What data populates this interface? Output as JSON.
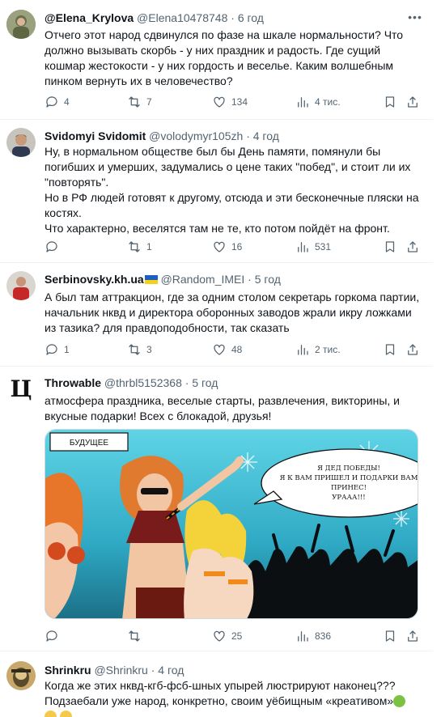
{
  "tweets": [
    {
      "name": "@Elena_Krylova",
      "handle": "@Elena10478748",
      "time": "6 год",
      "lines": [
        "Отчего этот народ сдвинулся по фазе на шкале нормальности? Что",
        "должно вызывать скорбь - у них праздник и радость. Где сущий",
        "кошмар жестокости - у них гордость и веселье. Каким волшебным",
        "пинком вернуть их в человечество?"
      ],
      "replies": "4",
      "reposts": "7",
      "likes": "134",
      "views": "4 тис."
    },
    {
      "name": "Svidomyi Svidomit",
      "handle": "@volodymyr105zh",
      "time": "4 год",
      "lines": [
        "Ну, в нормальном обществе был бы День памяти, помянули бы",
        "погибших и умерших, задумались о цене таких \"побед\", и стоит ли их",
        "\"повторять\".",
        "Но в РФ людей готовят к другому, отсюда и эти бесконечные пляски на",
        "костях.",
        "Что характерно, веселятся там не те, кто потом пойдёт на фронт."
      ],
      "replies": "",
      "reposts": "1",
      "likes": "16",
      "views": "531"
    },
    {
      "name": "Serbinovsky.kh.ua",
      "handle": "@Random_IMEI",
      "time": "5 год",
      "lines": [
        "А был там аттракцион, где за одним столом секретарь горкома партии,",
        "начальник нквд и директора оборонных заводов жрали икру ложками",
        "из тазика? для правдоподобности, так сказать"
      ],
      "replies": "1",
      "reposts": "3",
      "likes": "48",
      "views": "2 тис."
    },
    {
      "name": "Throwable",
      "handle": "@thrbl5152368",
      "time": "5 год",
      "avatar_letter": "Ц",
      "lines": [
        "атмосфера праздника, веселые старты, развлечения, викторины, и",
        "вкусные подарки! Всех с блокадой, друзья!"
      ],
      "replies": "",
      "reposts": "",
      "likes": "25",
      "views": "836",
      "image": {
        "caption": "БУДУЩЕЕ",
        "bubble": [
          "Я ДЕД ПОБЕДЫ!",
          "Я К ВАМ ПРИШЕЛ И ПОДАРКИ ВАМ",
          "ПРИНЕС!",
          "УРААА!!!"
        ]
      }
    },
    {
      "name": "Shrinkru",
      "handle": "@Shrinkru",
      "time": "4 год",
      "lines": [
        "Когда же этих нквд-кгб-фсб-шных упырей люстрируют наконец???",
        "Подзаебали уже народ, конкретно, своим уёбищным «креативом»"
      ]
    }
  ],
  "separator": "·",
  "more_icon": "ellipsis-icon",
  "colors": {
    "text": "#0f1419",
    "secondary": "#536471",
    "divider": "#eff3f4"
  }
}
